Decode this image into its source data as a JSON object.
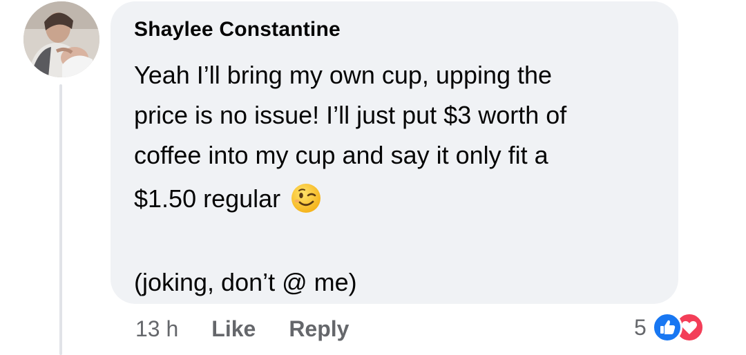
{
  "comment": {
    "author": "Shaylee Constantine",
    "lines": [
      "Yeah I’ll bring my own cup, upping the",
      "price is no issue! I’ll just put $3 worth of",
      "coffee into my cup and say it only fit a",
      "$1.50 regular"
    ],
    "emoji": "winking-face",
    "postscript": "(joking, don’t @ me)"
  },
  "actions": {
    "timestamp": "13 h",
    "like_label": "Like",
    "reply_label": "Reply"
  },
  "reactions": {
    "count": "5",
    "types": [
      "like",
      "love"
    ],
    "like_color": "#1877f2",
    "love_color": "#f33e58"
  },
  "colors": {
    "bubble": "#f0f2f5",
    "secondary_text": "#65676b",
    "primary_text": "#050505"
  }
}
